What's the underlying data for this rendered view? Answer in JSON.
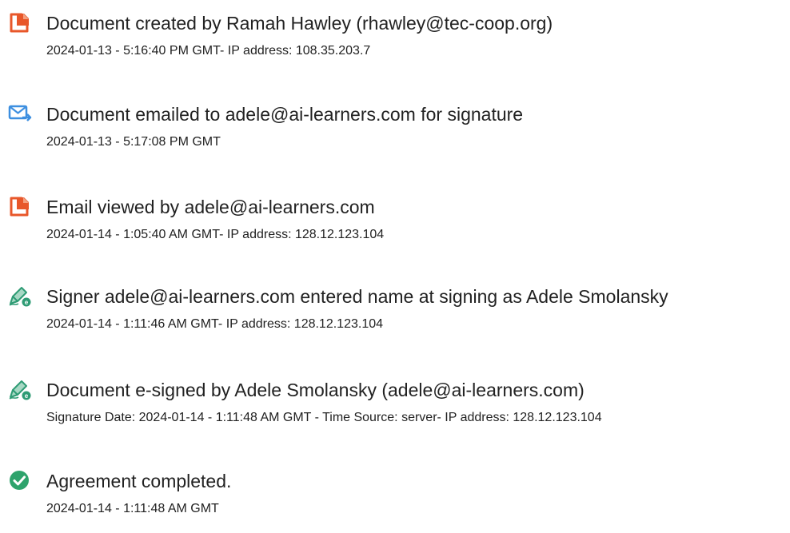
{
  "audit_trail": {
    "events": [
      {
        "icon": "document-created-icon",
        "title": "Document created by Ramah Hawley (rhawley@tec-coop.org)",
        "detail": "2024-01-13 - 5:16:40 PM GMT- IP address: 108.35.203.7"
      },
      {
        "icon": "email-sent-icon",
        "title": "Document emailed to adele@ai-learners.com for signature",
        "detail": "2024-01-13 - 5:17:08 PM GMT"
      },
      {
        "icon": "document-viewed-icon",
        "title": "Email viewed by adele@ai-learners.com",
        "detail": "2024-01-14 - 1:05:40 AM GMT- IP address: 128.12.123.104"
      },
      {
        "icon": "signer-pen-icon",
        "title": "Signer adele@ai-learners.com entered name at signing as Adele Smolansky",
        "detail": "2024-01-14 - 1:11:46 AM GMT- IP address: 128.12.123.104"
      },
      {
        "icon": "e-sign-pen-icon",
        "title": "Document e-signed by Adele Smolansky (adele@ai-learners.com)",
        "detail": "Signature Date: 2024-01-14 - 1:11:48 AM GMT - Time Source: server- IP address: 128.12.123.104"
      },
      {
        "icon": "checkmark-circle-icon",
        "title": "Agreement completed.",
        "detail": "2024-01-14 - 1:11:48 AM GMT"
      }
    ],
    "colors": {
      "document_icon": "#E8572A",
      "email_icon": "#3D8FE0",
      "pen_icon": "#2E9B74",
      "check_icon": "#2EA36C",
      "text": "#222222"
    }
  }
}
